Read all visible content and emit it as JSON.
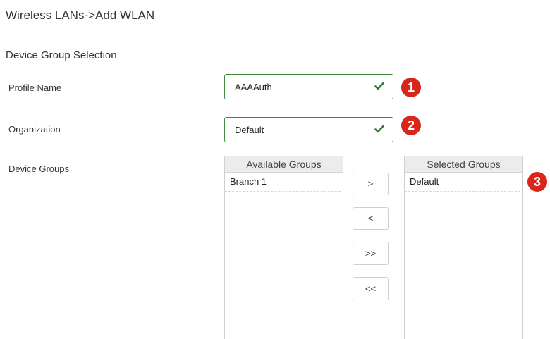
{
  "header": {
    "title": "Wireless LANs->Add WLAN"
  },
  "section": {
    "title": "Device Group Selection"
  },
  "profile_name": {
    "label": "Profile Name",
    "value": "AAAAuth",
    "badge": "1"
  },
  "organization": {
    "label": "Organization",
    "value": "Default",
    "badge": "2"
  },
  "device_groups": {
    "label": "Device Groups",
    "available": {
      "header": "Available Groups",
      "items": [
        "Branch 1"
      ]
    },
    "selected": {
      "header": "Selected Groups",
      "items": [
        "Default"
      ],
      "badge": "3"
    },
    "buttons": {
      "move_right": ">",
      "move_left": "<",
      "move_all_right": ">>",
      "move_all_left": "<<"
    }
  },
  "colors": {
    "valid_border": "#3f8a3c",
    "checkmark": "#2e7d32",
    "badge": "#d9251c"
  },
  "icons": {
    "valid": "checkmark-icon"
  }
}
